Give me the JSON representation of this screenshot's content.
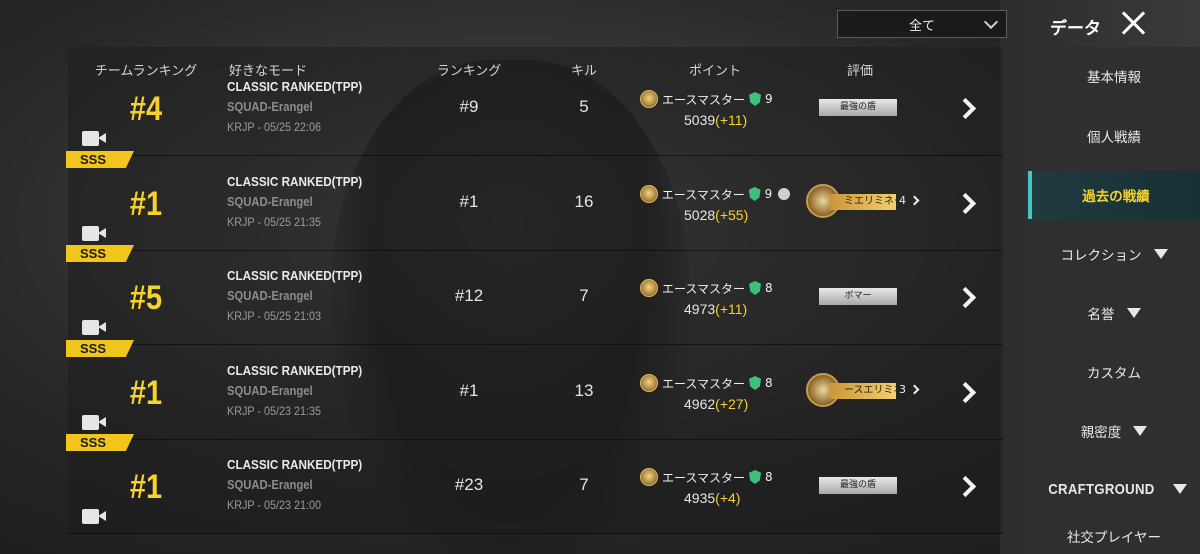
{
  "header": {
    "filter_value": "全て",
    "title": "データ"
  },
  "columns": {
    "team_ranking": "チームランキング",
    "mode": "好きなモード",
    "ranking": "ランキング",
    "kills": "キル",
    "points": "ポイント",
    "rating": "評価"
  },
  "rows": [
    {
      "team_rank": "#4",
      "grade": "",
      "mode": "CLASSIC RANKED(TPP)",
      "sub_mode": "SQUAD-Erangel",
      "server_time": "KRJP - 05/25 22:06",
      "ranking": "#9",
      "kills": "5",
      "tier": "エースマスター",
      "tier_level": "9",
      "score": "5039",
      "delta": "(+11)",
      "rating_type": "tag",
      "rating": "最強の盾"
    },
    {
      "team_rank": "#1",
      "grade": "SSS",
      "mode": "CLASSIC RANKED(TPP)",
      "sub_mode": "SQUAD-Erangel",
      "server_time": "KRJP - 05/25 21:35",
      "ranking": "#1",
      "kills": "16",
      "tier": "エースマスター",
      "tier_level": "9",
      "score": "5028",
      "delta": "(+55)",
      "rating_type": "achievement",
      "rating": "ミエリミネー",
      "rating_count": "4"
    },
    {
      "team_rank": "#5",
      "grade": "SSS",
      "mode": "CLASSIC RANKED(TPP)",
      "sub_mode": "SQUAD-Erangel",
      "server_time": "KRJP - 05/25 21:03",
      "ranking": "#12",
      "kills": "7",
      "tier": "エースマスター",
      "tier_level": "8",
      "score": "4973",
      "delta": "(+11)",
      "rating_type": "tag",
      "rating": "ボマー"
    },
    {
      "team_rank": "#1",
      "grade": "SSS",
      "mode": "CLASSIC RANKED(TPP)",
      "sub_mode": "SQUAD-Erangel",
      "server_time": "KRJP - 05/23 21:35",
      "ranking": "#1",
      "kills": "13",
      "tier": "エースマスター",
      "tier_level": "8",
      "score": "4962",
      "delta": "(+27)",
      "rating_type": "achievement",
      "rating": "ースエリミネ",
      "rating_count": "3"
    },
    {
      "team_rank": "#1",
      "grade": "SSS",
      "mode": "CLASSIC RANKED(TPP)",
      "sub_mode": "SQUAD-Erangel",
      "server_time": "KRJP - 05/23 21:00",
      "ranking": "#23",
      "kills": "7",
      "tier": "エースマスター",
      "tier_level": "8",
      "score": "4935",
      "delta": "(+4)",
      "rating_type": "tag",
      "rating": "最強の盾"
    }
  ],
  "sidebar": {
    "items": [
      {
        "label": "基本情報"
      },
      {
        "label": "個人戦績"
      },
      {
        "label": "過去の戦績",
        "active": true
      },
      {
        "label": "コレクション",
        "expandable": true
      },
      {
        "label": "名誉",
        "expandable": true
      },
      {
        "label": "カスタム"
      },
      {
        "label": "親密度",
        "expandable": true
      },
      {
        "label": "CRAFTGROUND",
        "expandable": true
      },
      {
        "label": "社交プレイヤー"
      }
    ]
  },
  "colors": {
    "accent_yellow": "#f5d22d",
    "active_teal": "#48c6c6",
    "tier_shield_green": "#3ec07a"
  }
}
